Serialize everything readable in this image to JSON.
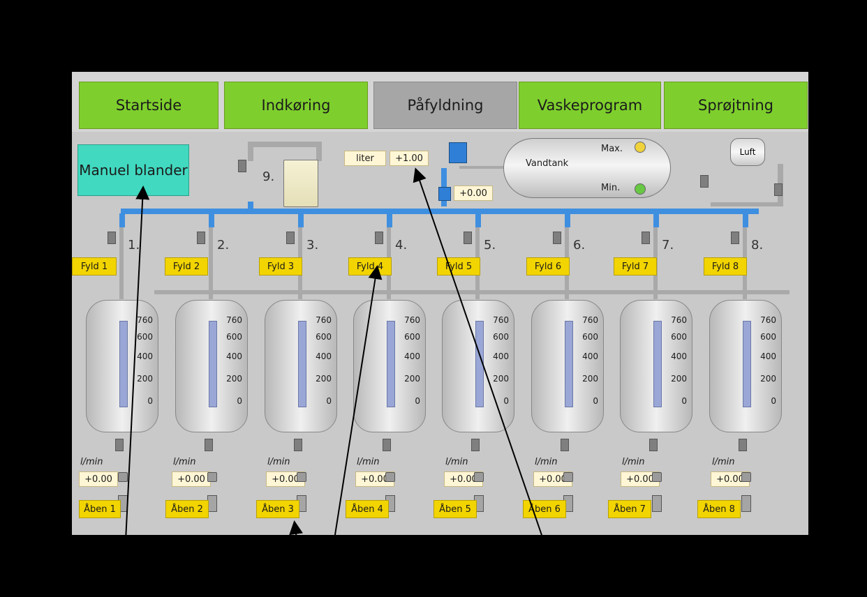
{
  "tabs": [
    {
      "label": "Startside",
      "active": false
    },
    {
      "label": "Indkøring",
      "active": false
    },
    {
      "label": "Påfyldning",
      "active": true
    },
    {
      "label": "Vaskeprogram",
      "active": false
    },
    {
      "label": "Sprøjtning",
      "active": false
    }
  ],
  "manual_button": "Manuel blander",
  "top_controls": {
    "liter_label": "liter",
    "liter_value": "+1.00",
    "flow_value": "+0.00"
  },
  "valve_9_label": "9.",
  "vandtank": {
    "label": "Vandtank",
    "max_label": "Max.",
    "min_label": "Min."
  },
  "air_tank_label": "Luft",
  "branch_numbers": [
    "1.",
    "2.",
    "3.",
    "4.",
    "5.",
    "6.",
    "7.",
    "8."
  ],
  "fill_buttons": [
    "Fyld 1",
    "Fyld 2",
    "Fyld 3",
    "Fyld 4",
    "Fyld 5",
    "Fyld 6",
    "Fyld 7",
    "Fyld 8"
  ],
  "tank_scale": [
    "760",
    "600",
    "400",
    "200",
    "0"
  ],
  "flow_unit": "l/min",
  "flow_values": [
    "+0.00",
    "+0.00",
    "+0.00",
    "+0.00",
    "+0.00",
    "+0.00",
    "+0.00",
    "+0.00"
  ],
  "open_buttons": [
    "Åben 1",
    "Åben 2",
    "Åben 3",
    "Åben 4",
    "Åben 5",
    "Åben 6",
    "Åben 7",
    "Åben 8"
  ],
  "colors": {
    "tab_green": "#7ecf2d",
    "tab_active": "#a6a6a6",
    "manual_teal": "#41d9c0",
    "button_yellow": "#f2d400",
    "pipe_blue": "#3f8fe0",
    "max_indicator": "#f0d33c",
    "min_indicator": "#68c843"
  }
}
